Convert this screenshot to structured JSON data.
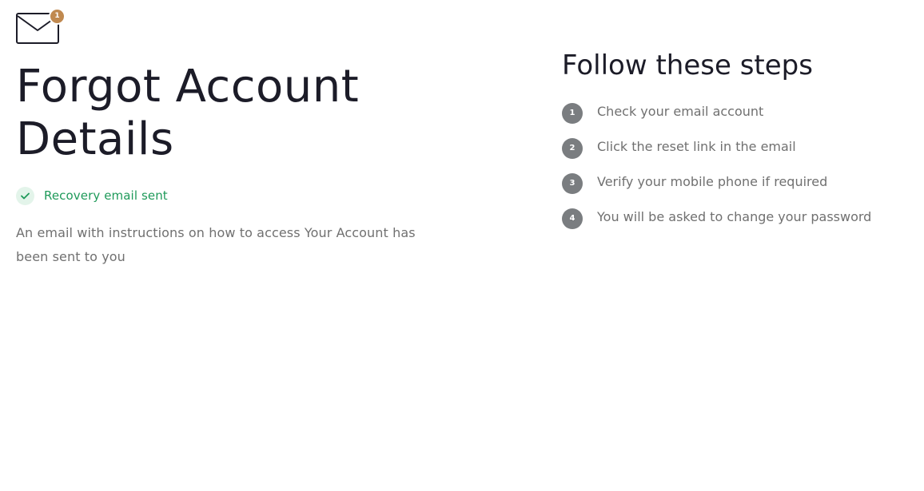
{
  "mail": {
    "icon": "mail-icon",
    "badge_count": "1",
    "badge_color": "#c0894f"
  },
  "main": {
    "title": "Forgot Account Details",
    "status": {
      "icon": "check-icon",
      "text": "Recovery email sent",
      "color": "#1f9a5a"
    },
    "description": "An email with instructions on how to access Your Account has been sent to you"
  },
  "steps": {
    "title": "Follow these steps",
    "items": [
      {
        "number": "1",
        "text": "Check your email account"
      },
      {
        "number": "2",
        "text": "Click the reset link in the email"
      },
      {
        "number": "3",
        "text": "Verify your mobile phone if required"
      },
      {
        "number": "4",
        "text": "You will be asked to change your password"
      }
    ]
  }
}
